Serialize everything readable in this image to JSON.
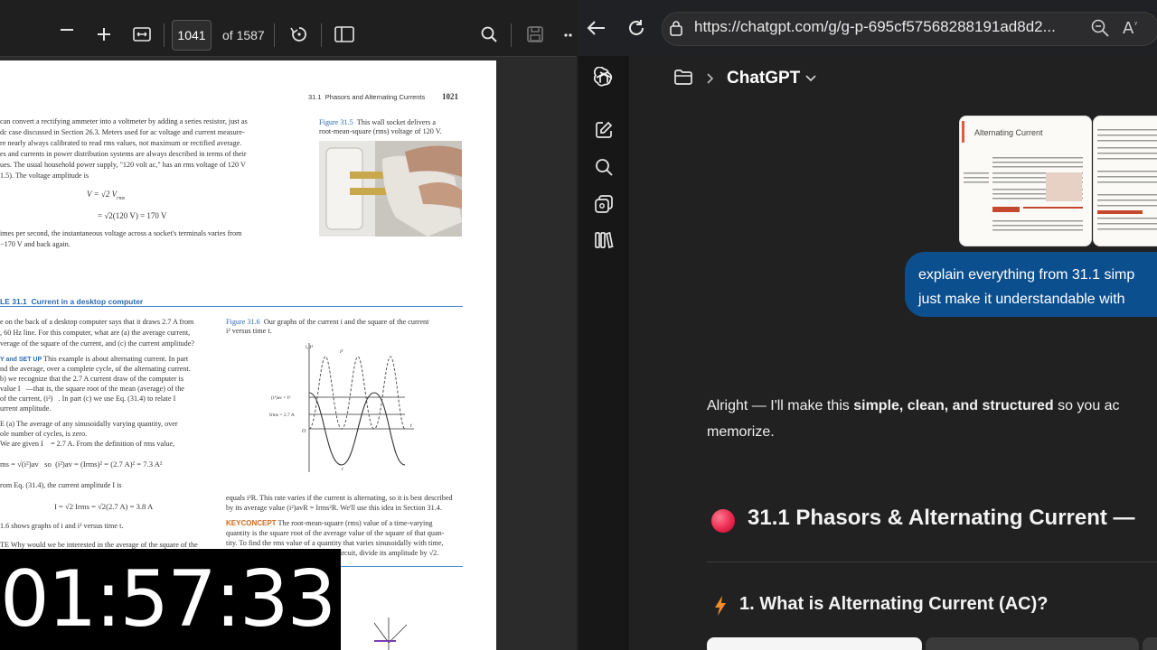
{
  "pdf_viewer": {
    "page_number": "1041",
    "page_total_label": "of 1587",
    "page": {
      "running_head": "31.1  Phasors and Alternating Currents",
      "page_num": "1021",
      "para1": [
        "can convert a rectifying ammeter into a voltmeter by adding a series resistor, just as",
        "dc case discussed in Section 26.3. Meters used for ac voltage and current measure-",
        "re nearly always calibrated to read rms values, not maximum or rectified average.",
        "es and currents in power distribution systems are always described in terms of their",
        "ues. The usual household power supply, \"120 volt ac,\" has an rms voltage of 120 V",
        "1.5). The voltage amplitude is"
      ],
      "eq1": "V = √2 V",
      "eq1_sub": "rms",
      "eq2": "= √2(120 V) = 170 V",
      "para2": [
        "imes per second, the instantaneous voltage across a socket's terminals varies from",
        "−170 V and back again."
      ],
      "fig315_label": "Figure 31.5",
      "fig315_caption": [
        "This wall socket delivers a",
        "root-mean-square (rms) voltage of 120 V."
      ],
      "example_heading": "LE 31.1  Current in a desktop computer",
      "example_text": [
        "e on the back of a desktop computer says that it draws 2.7 A from",
        ", 60 Hz line. For this computer, what are (a) the average current,",
        "verage of the square of the current, and (c) the current amplitude?"
      ],
      "identify_label": "Y and SET UP",
      "identify_text": [
        "This example is about alternating current. In part",
        "nd the average, over a complete cycle, of the alternating current.",
        "b) we recognize that the 2.7 A current draw of the computer is",
        "value I   —that is, the square root of the mean (average) of the",
        "of the current, (i²)   . In part (c) we use Eq. (31.4) to relate I",
        "urrent amplitude."
      ],
      "execute_text": [
        "E (a) The average of any sinusoidally varying quantity, over",
        "ole number of cycles, is zero.",
        "We are given I    = 2.7 A. From the definition of rms value,"
      ],
      "eq3": "ms = √(i²)av   so  (i²)av = (Irms)² = (2.7 A)² = 7.3 A²",
      "from_eq": "rom Eq. (31.4), the current amplitude I is",
      "eq4": "I = √2 Irms = √2(2.7 A) = 3.8 A",
      "fig_shows": "1.6 shows graphs of i and i² versus time t.",
      "evaluate": "TE Why would we be interested in the average of the square of the",
      "fig316_label": "Figure 31.6",
      "fig316_caption": [
        "Our graphs of the current i and the square of the current",
        "i² versus time t."
      ],
      "graph_labels": {
        "i_axis": "i, i²",
        "i2": "i²",
        "irms2": "(i²)av = I²",
        "irms": "Irms = 2.7 A",
        "origin": "O",
        "t": "t",
        "i": "i"
      },
      "right_text": [
        "equals i²R. This rate varies if the current is alternating, so it is best described",
        "by its average value (i²)avR = Irms²R. We'll use this idea in Section 31.4."
      ],
      "keyconcept_label": "KEYCONCEPT",
      "keyconcept_text": [
        "The root-mean-square (rms) value of a time-varying",
        "quantity is the square root of the average value of the square of that quan-",
        "tity. To find the rms value of a quantity that varies sinusoidally with time,",
        "ircuit, divide its amplitude by √2."
      ]
    }
  },
  "timer": {
    "value": "01:57:33"
  },
  "browser": {
    "url": "https://chatgpt.com/g/g-p-695cf57568288191ad8d2..."
  },
  "chat": {
    "title": "ChatGPT",
    "thumbnail_title": "Alternating Current",
    "user_message_lines": [
      "explain everything from 31.1 simp",
      "just make it understandable with"
    ],
    "reply": {
      "line1_pre": "Alright — I'll make this ",
      "line1_bold": "simple, clean, and structured",
      "line1_post": " so you ac",
      "line2": "memorize."
    },
    "heading1": "31.1 Phasors & Alternating Current —",
    "heading2": "1. What is Alternating Current (AC)?"
  },
  "colors": {
    "accent_blue": "#0b4f8f",
    "section_dot": "#e8234a",
    "bolt": "#f28c28"
  }
}
